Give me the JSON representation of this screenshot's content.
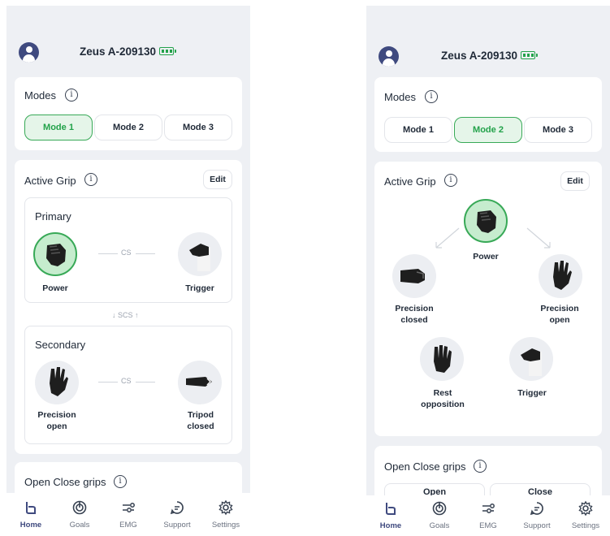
{
  "device": {
    "name": "Zeus A-209130"
  },
  "modes": {
    "title": "Modes",
    "buttons": [
      "Mode 1",
      "Mode 2",
      "Mode 3"
    ],
    "active_left": "Mode 1",
    "active_right": "Mode 2"
  },
  "active_grip": {
    "title": "Active Grip",
    "edit_label": "Edit",
    "primary": {
      "title": "Primary",
      "left": "Power",
      "right": "Trigger",
      "connector": "CS"
    },
    "switch_label": "SCS",
    "secondary": {
      "title": "Secondary",
      "left": "Precision\nopen",
      "right": "Tripod\nclosed",
      "connector": "CS"
    },
    "cycle": {
      "center": "Power",
      "left": "Precision\nclosed",
      "right": "Precision\nopen",
      "bottom_left": "Rest\nopposition",
      "bottom_right": "Trigger"
    }
  },
  "open_close": {
    "title": "Open Close grips",
    "open_label": "Open",
    "close_label": "Close"
  },
  "nav": {
    "items": [
      {
        "label": "Home",
        "icon": "home-hand-icon"
      },
      {
        "label": "Goals",
        "icon": "target-icon"
      },
      {
        "label": "EMG",
        "icon": "emg-icon"
      },
      {
        "label": "Support",
        "icon": "chat-icon"
      },
      {
        "label": "Settings",
        "icon": "gear-icon"
      }
    ],
    "active": "Home"
  },
  "colors": {
    "accent_green": "#22a24a",
    "active_fill": "#e5f5e9",
    "brand_navy": "#3f4a7f",
    "background": "#eef0f4"
  }
}
